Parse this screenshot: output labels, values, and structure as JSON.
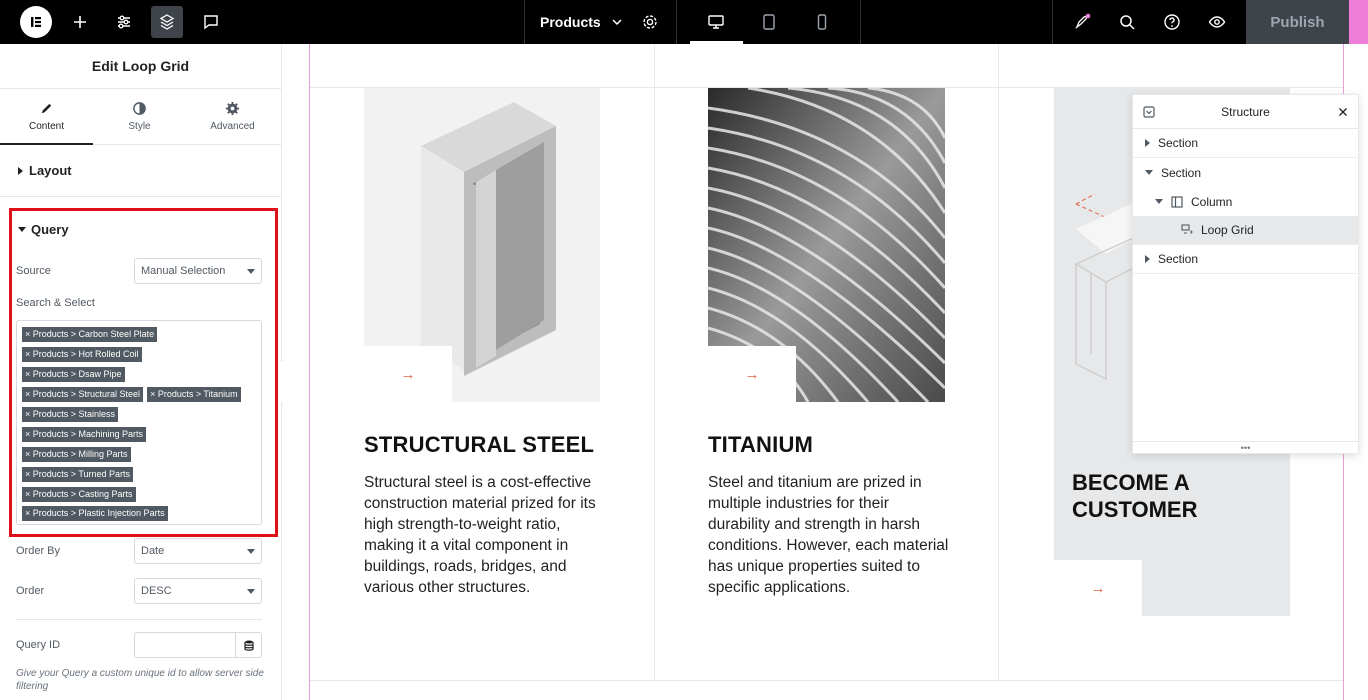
{
  "topbar": {
    "page_label": "Products",
    "publish_label": "Publish"
  },
  "panel": {
    "title": "Edit Loop Grid",
    "tabs": [
      {
        "label": "Content",
        "icon": "pencil-icon"
      },
      {
        "label": "Style",
        "icon": "contrast-icon"
      },
      {
        "label": "Advanced",
        "icon": "gear-icon"
      }
    ],
    "layout_label": "Layout",
    "query_label": "Query",
    "source_label": "Source",
    "source_value": "Manual Selection",
    "search_label": "Search & Select",
    "tags": [
      [
        "× Products > Carbon Steel Plate"
      ],
      [
        "× Products > Hot Rolled Coil"
      ],
      [
        "× Products > Dsaw Pipe"
      ],
      [
        "× Products > Structural Steel",
        "× Products > Titanium"
      ],
      [
        "× Products > Stainless"
      ],
      [
        "× Products > Machining Parts"
      ],
      [
        "× Products > Milling Parts"
      ],
      [
        "× Products > Turned Parts"
      ],
      [
        "× Products > Casting Parts"
      ],
      [
        "× Products > Plastic Injection Parts"
      ]
    ],
    "order_by_label": "Order By",
    "order_by_value": "Date",
    "order_label": "Order",
    "order_value": "DESC",
    "query_id_label": "Query ID",
    "query_id_help": "Give your Query a custom unique id to allow server side filtering"
  },
  "canvas": {
    "cards": [
      {
        "title": "STRUCTURAL STEEL",
        "description": "Structural steel is a cost-effective construction material prized for its high strength-to-weight ratio, making it a vital component in buildings, roads, bridges, and various other structures."
      },
      {
        "title": "TITANIUM",
        "description": "Steel and titanium are prized in multiple industries for their durability and strength in harsh conditions. However, each material has unique properties suited to specific applications."
      }
    ],
    "cta_title": "BECOME A CUSTOMER",
    "arrow": "→"
  },
  "structure": {
    "title": "Structure",
    "items": [
      "Section",
      "Section",
      "Column",
      "Loop Grid",
      "Section"
    ]
  },
  "colors": {
    "accent_red": "#e0101a",
    "arrow_orange": "#e0623d",
    "topbar": "#000000"
  }
}
